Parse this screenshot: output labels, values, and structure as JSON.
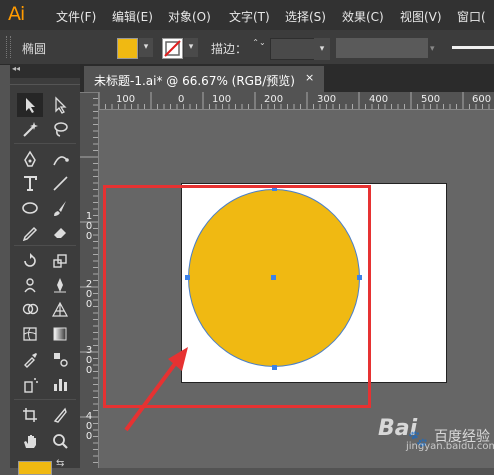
{
  "app": {
    "logo": "Ai",
    "brand_color": "#ff9a00"
  },
  "menu": [
    "文件(F)",
    "编辑(E)",
    "对象(O)",
    "文字(T)",
    "选择(S)",
    "效果(C)",
    "视图(V)",
    "窗口("
  ],
  "control_bar": {
    "shape_label": "椭圆",
    "fill_color": "#f0b912",
    "stroke_label": "描边：",
    "stroke_value": "",
    "dropdown_glyph": "▾",
    "stepper_glyph": "⌃⌄"
  },
  "toolbar": {
    "collapse_glyph": "◂◂",
    "tools": [
      "selection-tool-icon",
      "direct-selection-tool-icon",
      "magic-wand-tool-icon",
      "lasso-tool-icon",
      "pen-tool-icon",
      "curvature-tool-icon",
      "type-tool-icon",
      "line-segment-tool-icon",
      "ellipse-tool-icon",
      "paintbrush-tool-icon",
      "pencil-tool-icon",
      "eraser-tool-icon",
      "rotate-tool-icon",
      "scale-tool-icon",
      "puppet-warp-tool-icon",
      "free-transform-tool-icon",
      "shape-builder-tool-icon",
      "perspective-grid-tool-icon",
      "mesh-tool-icon",
      "gradient-tool-icon",
      "eyedropper-tool-icon",
      "blend-tool-icon",
      "symbol-sprayer-tool-icon",
      "column-graph-tool-icon",
      "artboard-tool-icon",
      "slice-tool-icon",
      "hand-tool-icon",
      "zoom-tool-icon"
    ]
  },
  "document": {
    "tab_title": "未标题-1.ai* @ 66.67% (RGB/预览)",
    "close_glyph": "×"
  },
  "rulers": {
    "horizontal": [
      "100",
      "0",
      "100",
      "200",
      "300",
      "400",
      "500",
      "600",
      "700"
    ],
    "vertical": [
      "1 0 0",
      "2 0 0",
      "3 0 0",
      "4 0 0"
    ]
  },
  "artwork": {
    "circle_color": "#f0b912",
    "selection_color": "#3b82e8",
    "highlight_color": "#e63232"
  },
  "watermark": {
    "brand": "Bai",
    "symbol": "🐾",
    "suffix": "百度经验",
    "url": "jingyan.baidu.com"
  }
}
